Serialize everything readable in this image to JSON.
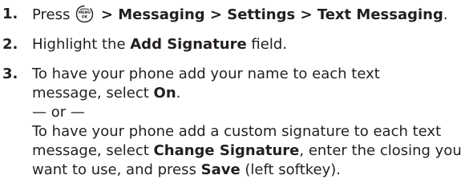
{
  "steps": [
    {
      "number": "1.",
      "press": "Press",
      "menu_icon": "menu-ok-key-icon",
      "menu_icon_text_top": "MENU",
      "menu_icon_text_bottom": "OK",
      "path": "> Messaging > Settings > Text Messaging",
      "period": "."
    },
    {
      "number": "2.",
      "pre": "Highlight the ",
      "field": "Add Signature",
      "post": " field."
    },
    {
      "number": "3.",
      "line1": "To have your phone add your name to each text",
      "line2_pre": "message, select ",
      "on": "On",
      "line2_post": ".",
      "or": "— or —",
      "line4": "To have your phone add a custom signature to each text",
      "line5_pre": "message, select ",
      "change_signature": "Change Signature",
      "line5_post": ", enter the closing you",
      "line6_pre": "want to use, and press ",
      "save": "Save",
      "line6_post": " (left softkey)."
    }
  ]
}
